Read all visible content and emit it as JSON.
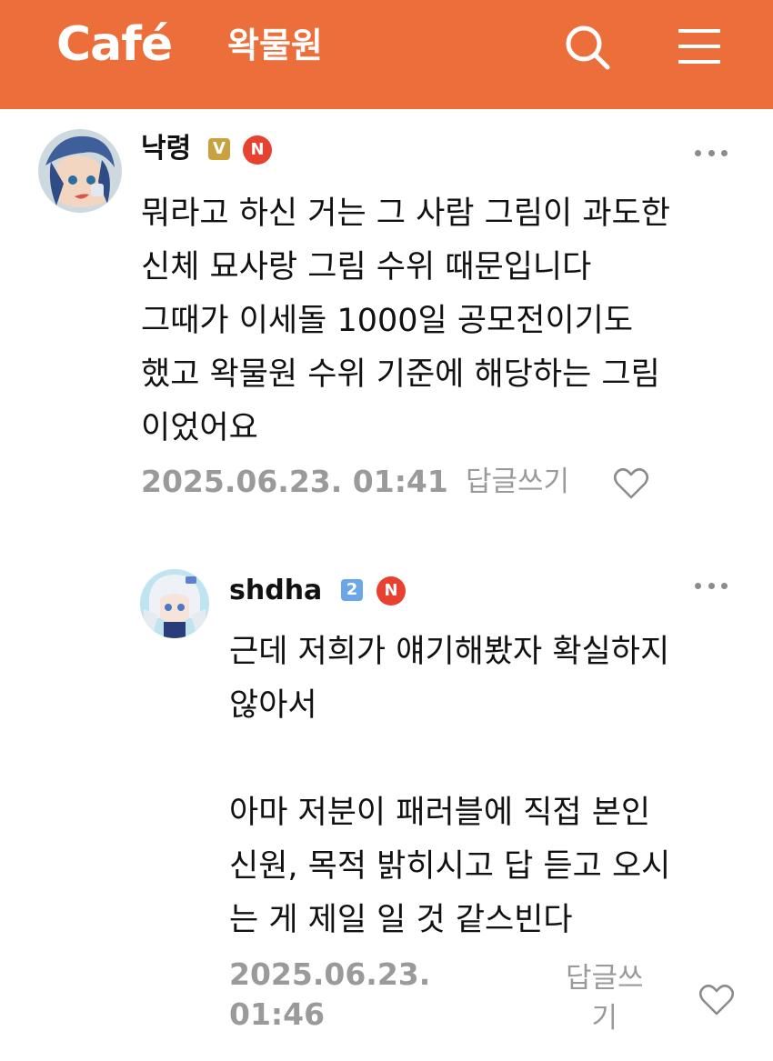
{
  "header": {
    "logo_text": "Café",
    "cafe_name": "왁물원",
    "bg_color": "#ec6f3b",
    "icons": [
      "search-icon",
      "menu-icon"
    ]
  },
  "comments": [
    {
      "author": "낙령",
      "level_badge": "V",
      "new_badge": "N",
      "text": "뭐라고 하신 거는 그 사람 그림이 과도한\n신체 묘사랑 그림 수위 때문입니다\n그때가 이세돌 1000일 공모전이기도\n했고 왁물원 수위 기준에 해당하는 그림\n이었어요",
      "date": "2025.06.23. 01:41",
      "reply_label": "답글쓰기"
    },
    {
      "author": "shdha",
      "level_badge": "2",
      "new_badge": "N",
      "text": "근데 저희가 얘기해봤자 확실하지\n않아서\n\n아마 저분이 패러블에 직접 본인\n신원, 목적 밝히시고 답 듣고 오시\n는 게 제일 일 것 같스빈다",
      "date": "2025.06.23.\n01:46",
      "reply_label": "답글쓰\n기"
    }
  ]
}
